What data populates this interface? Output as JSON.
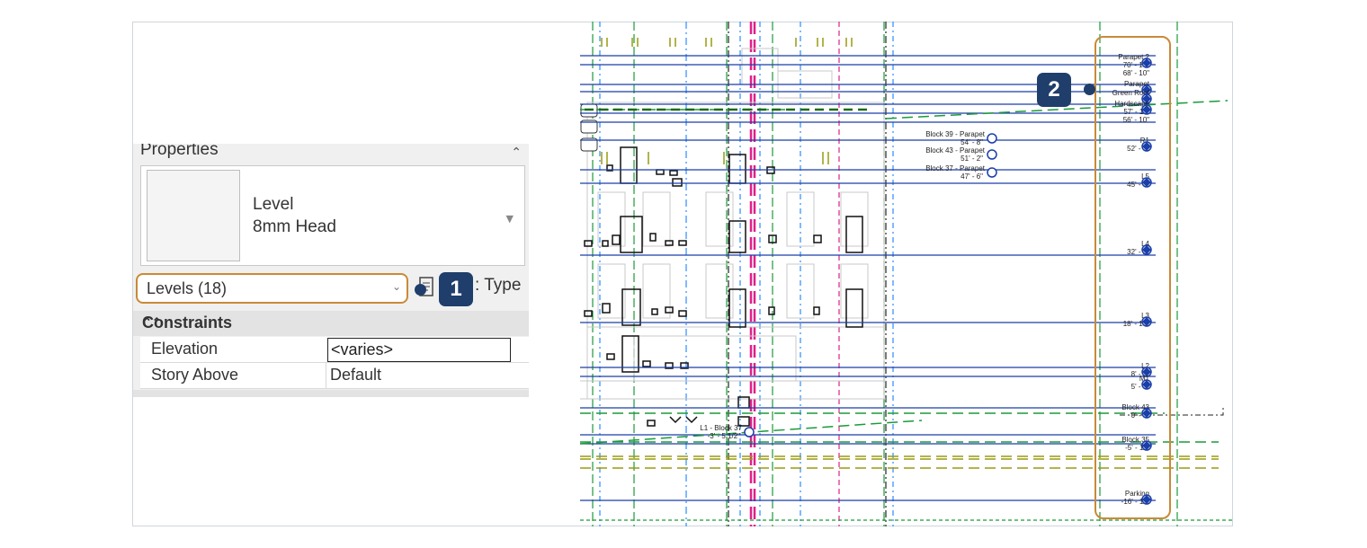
{
  "properties": {
    "title": "Properties",
    "family_name": "Level",
    "type_name": "8mm Head",
    "selector_value": "Levels (18)",
    "type_button_label": ": Type",
    "section": "Constraints",
    "rows": [
      {
        "key": "Elevation",
        "value": "<varies>"
      },
      {
        "key": "Story Above",
        "value": "Default"
      }
    ]
  },
  "callouts": {
    "one": "1",
    "two": "2"
  },
  "levels": [
    {
      "name": "Parapet 2",
      "elev": "70' - 10\"",
      "elev2": "68' - 10\""
    },
    {
      "name": "Parapet",
      "elev": ""
    },
    {
      "name": "Green Roof",
      "elev": ""
    },
    {
      "name": "Hardscape",
      "elev": "57' - 11\"",
      "elev2": "56' - 10\""
    },
    {
      "name": "R1",
      "elev": "52' - 8\""
    },
    {
      "name": "L5",
      "elev": "45' - 6\""
    },
    {
      "name": "L4",
      "elev": "32' - 2\""
    },
    {
      "name": "L3",
      "elev": "18' - 10\""
    },
    {
      "name": "L2",
      "elev": "8' - 7\""
    },
    {
      "name": "M1",
      "elev": "5' - 6\""
    },
    {
      "name": "Block 43",
      "elev": "0' - 0\""
    },
    {
      "name": "Block 35",
      "elev": "-5' - 11\""
    },
    {
      "name": "Parking",
      "elev": "-16' - 11\""
    }
  ],
  "mid_levels": [
    {
      "name": "Block 39 - Parapet",
      "elev": "54' - 8\""
    },
    {
      "name": "Block 43 - Parapet",
      "elev": "51' - 2\""
    },
    {
      "name": "Block 37 - Parapet",
      "elev": "47' - 6\""
    },
    {
      "name": "L1 - Block 37",
      "elev": "-3' - 5 1/2\""
    }
  ],
  "colors": {
    "accent": "#c98a38",
    "callout": "#1f3e6b",
    "level_line": "#1a3fa8"
  }
}
